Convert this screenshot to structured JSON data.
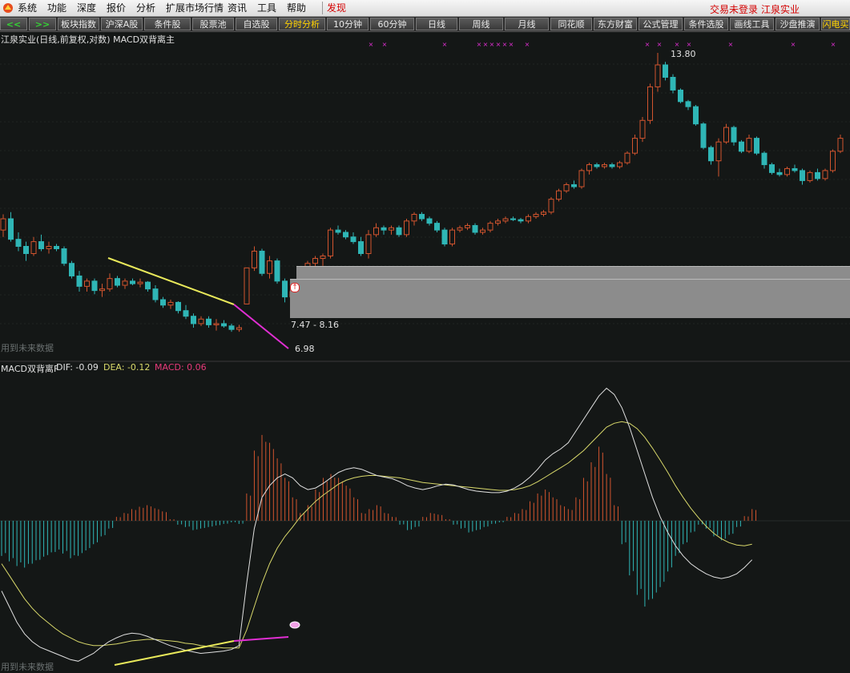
{
  "menubar": {
    "items": [
      "系统",
      "功能",
      "深度",
      "报价",
      "分析",
      "扩展市场行情",
      "资讯",
      "工具",
      "帮助",
      "发现"
    ],
    "status_login": "交易未登录",
    "status_stock": "江泉实业"
  },
  "toolbar": {
    "tabs": [
      "<<",
      ">>",
      "板块指数",
      "沪深A股",
      "条件股",
      "股票池",
      "自选股",
      "分时分析",
      "10分钟",
      "60分钟",
      "日线",
      "周线",
      "月线",
      "同花顺",
      "东方财富",
      "公式管理",
      "条件选股",
      "画线工具",
      "沙盘推演",
      "闪电买"
    ]
  },
  "price_panel": {
    "title": "江泉实业(日线,前复权,对数) MACD双背离主",
    "future_data_note": "用到未来数据",
    "high_label": "13.80",
    "range_label": "7.47 - 8.16",
    "low_label": "6.98"
  },
  "macd_panel": {
    "title": "MACD双背离F",
    "dif_label": "DIF: -0.09",
    "dea_label": "DEA: -0.12",
    "macd_label": "MACD: 0.06",
    "future_data_note": "用到未来数据"
  },
  "colors": {
    "up": "#d2542e",
    "down": "#2fb6b6",
    "divergence_yellow": "#e8e85a",
    "divergence_magenta": "#e02ed2",
    "dif_line": "#e0e0e0",
    "dea_line": "#d8d86a",
    "macd_label": "#e83a7a",
    "background": "#141716"
  },
  "chart_data": {
    "type": "candlestick",
    "notes": "Daily OHLC (front-adjusted, log scale) for 江泉实业 with MACD histogram (DIF/DEA).",
    "price_series": [
      {
        "o": 8.95,
        "h": 9.3,
        "l": 8.8,
        "c": 9.2
      },
      {
        "o": 9.2,
        "h": 9.35,
        "l": 8.7,
        "c": 8.75
      },
      {
        "o": 8.75,
        "h": 8.9,
        "l": 8.5,
        "c": 8.6
      },
      {
        "o": 8.6,
        "h": 8.7,
        "l": 8.3,
        "c": 8.45
      },
      {
        "o": 8.45,
        "h": 8.8,
        "l": 8.4,
        "c": 8.7
      },
      {
        "o": 8.7,
        "h": 8.85,
        "l": 8.5,
        "c": 8.55
      },
      {
        "o": 8.55,
        "h": 8.7,
        "l": 8.45,
        "c": 8.6
      },
      {
        "o": 8.6,
        "h": 8.65,
        "l": 8.5,
        "c": 8.55
      },
      {
        "o": 8.55,
        "h": 8.6,
        "l": 8.2,
        "c": 8.25
      },
      {
        "o": 8.25,
        "h": 8.3,
        "l": 7.95,
        "c": 8.0
      },
      {
        "o": 8.0,
        "h": 8.1,
        "l": 7.7,
        "c": 7.8
      },
      {
        "o": 7.8,
        "h": 7.95,
        "l": 7.7,
        "c": 7.9
      },
      {
        "o": 7.9,
        "h": 7.95,
        "l": 7.65,
        "c": 7.72
      },
      {
        "o": 7.72,
        "h": 7.85,
        "l": 7.6,
        "c": 7.75
      },
      {
        "o": 7.75,
        "h": 8.05,
        "l": 7.7,
        "c": 7.95
      },
      {
        "o": 7.95,
        "h": 8.0,
        "l": 7.78,
        "c": 7.82
      },
      {
        "o": 7.82,
        "h": 7.95,
        "l": 7.75,
        "c": 7.9
      },
      {
        "o": 7.9,
        "h": 7.95,
        "l": 7.82,
        "c": 7.85
      },
      {
        "o": 7.85,
        "h": 7.95,
        "l": 7.78,
        "c": 7.88
      },
      {
        "o": 7.88,
        "h": 7.9,
        "l": 7.7,
        "c": 7.75
      },
      {
        "o": 7.75,
        "h": 7.82,
        "l": 7.5,
        "c": 7.55
      },
      {
        "o": 7.55,
        "h": 7.6,
        "l": 7.4,
        "c": 7.45
      },
      {
        "o": 7.45,
        "h": 7.55,
        "l": 7.38,
        "c": 7.5
      },
      {
        "o": 7.5,
        "h": 7.52,
        "l": 7.3,
        "c": 7.35
      },
      {
        "o": 7.35,
        "h": 7.45,
        "l": 7.2,
        "c": 7.25
      },
      {
        "o": 7.25,
        "h": 7.3,
        "l": 7.05,
        "c": 7.12
      },
      {
        "o": 7.12,
        "h": 7.25,
        "l": 7.08,
        "c": 7.2
      },
      {
        "o": 7.2,
        "h": 7.25,
        "l": 7.05,
        "c": 7.1
      },
      {
        "o": 7.1,
        "h": 7.2,
        "l": 7.0,
        "c": 7.12
      },
      {
        "o": 7.12,
        "h": 7.18,
        "l": 7.05,
        "c": 7.08
      },
      {
        "o": 7.08,
        "h": 7.12,
        "l": 6.98,
        "c": 7.02
      },
      {
        "o": 7.02,
        "h": 7.1,
        "l": 6.98,
        "c": 7.05
      },
      {
        "o": 7.47,
        "h": 8.16,
        "l": 7.47,
        "c": 8.16
      },
      {
        "o": 8.16,
        "h": 8.6,
        "l": 8.1,
        "c": 8.5
      },
      {
        "o": 8.5,
        "h": 8.55,
        "l": 8.0,
        "c": 8.05
      },
      {
        "o": 8.05,
        "h": 8.4,
        "l": 7.95,
        "c": 8.3
      },
      {
        "o": 8.3,
        "h": 8.35,
        "l": 7.85,
        "c": 7.9
      },
      {
        "o": 7.9,
        "h": 7.95,
        "l": 7.5,
        "c": 7.6
      },
      {
        "o": 7.6,
        "h": 7.8,
        "l": 7.45,
        "c": 7.7
      },
      {
        "o": 7.7,
        "h": 8.05,
        "l": 7.65,
        "c": 8.0
      },
      {
        "o": 8.0,
        "h": 8.3,
        "l": 7.95,
        "c": 8.25
      },
      {
        "o": 8.25,
        "h": 8.4,
        "l": 8.15,
        "c": 8.35
      },
      {
        "o": 8.35,
        "h": 8.45,
        "l": 8.2,
        "c": 8.4
      },
      {
        "o": 8.4,
        "h": 9.0,
        "l": 8.35,
        "c": 8.95
      },
      {
        "o": 8.95,
        "h": 9.05,
        "l": 8.85,
        "c": 8.9
      },
      {
        "o": 8.9,
        "h": 8.95,
        "l": 8.75,
        "c": 8.8
      },
      {
        "o": 8.8,
        "h": 8.9,
        "l": 8.65,
        "c": 8.7
      },
      {
        "o": 8.7,
        "h": 8.8,
        "l": 8.4,
        "c": 8.45
      },
      {
        "o": 8.45,
        "h": 8.95,
        "l": 8.35,
        "c": 8.85
      },
      {
        "o": 8.85,
        "h": 9.1,
        "l": 8.8,
        "c": 9.0
      },
      {
        "o": 9.0,
        "h": 9.05,
        "l": 8.85,
        "c": 8.95
      },
      {
        "o": 8.95,
        "h": 9.05,
        "l": 8.85,
        "c": 9.0
      },
      {
        "o": 9.0,
        "h": 9.05,
        "l": 8.8,
        "c": 8.85
      },
      {
        "o": 8.85,
        "h": 9.2,
        "l": 8.8,
        "c": 9.15
      },
      {
        "o": 9.15,
        "h": 9.35,
        "l": 9.05,
        "c": 9.3
      },
      {
        "o": 9.3,
        "h": 9.35,
        "l": 9.15,
        "c": 9.2
      },
      {
        "o": 9.2,
        "h": 9.25,
        "l": 9.05,
        "c": 9.1
      },
      {
        "o": 9.1,
        "h": 9.15,
        "l": 8.9,
        "c": 8.95
      },
      {
        "o": 8.95,
        "h": 9.0,
        "l": 8.6,
        "c": 8.65
      },
      {
        "o": 8.65,
        "h": 9.0,
        "l": 8.6,
        "c": 8.95
      },
      {
        "o": 8.95,
        "h": 9.05,
        "l": 8.9,
        "c": 9.0
      },
      {
        "o": 9.0,
        "h": 9.1,
        "l": 8.95,
        "c": 9.05
      },
      {
        "o": 9.05,
        "h": 9.1,
        "l": 8.85,
        "c": 8.9
      },
      {
        "o": 8.9,
        "h": 9.0,
        "l": 8.85,
        "c": 8.95
      },
      {
        "o": 8.95,
        "h": 9.15,
        "l": 8.9,
        "c": 9.1
      },
      {
        "o": 9.1,
        "h": 9.2,
        "l": 9.05,
        "c": 9.15
      },
      {
        "o": 9.15,
        "h": 9.25,
        "l": 9.1,
        "c": 9.2
      },
      {
        "o": 9.2,
        "h": 9.25,
        "l": 9.15,
        "c": 9.18
      },
      {
        "o": 9.18,
        "h": 9.22,
        "l": 9.1,
        "c": 9.15
      },
      {
        "o": 9.15,
        "h": 9.3,
        "l": 9.1,
        "c": 9.25
      },
      {
        "o": 9.25,
        "h": 9.35,
        "l": 9.2,
        "c": 9.3
      },
      {
        "o": 9.3,
        "h": 9.4,
        "l": 9.25,
        "c": 9.35
      },
      {
        "o": 9.35,
        "h": 9.7,
        "l": 9.3,
        "c": 9.65
      },
      {
        "o": 9.65,
        "h": 9.9,
        "l": 9.6,
        "c": 9.85
      },
      {
        "o": 9.85,
        "h": 10.05,
        "l": 9.8,
        "c": 10.0
      },
      {
        "o": 10.0,
        "h": 10.1,
        "l": 9.9,
        "c": 9.95
      },
      {
        "o": 9.95,
        "h": 10.4,
        "l": 9.9,
        "c": 10.35
      },
      {
        "o": 10.35,
        "h": 10.55,
        "l": 10.25,
        "c": 10.5
      },
      {
        "o": 10.5,
        "h": 10.55,
        "l": 10.4,
        "c": 10.45
      },
      {
        "o": 10.45,
        "h": 10.55,
        "l": 10.4,
        "c": 10.5
      },
      {
        "o": 10.5,
        "h": 10.55,
        "l": 10.4,
        "c": 10.45
      },
      {
        "o": 10.45,
        "h": 10.6,
        "l": 10.4,
        "c": 10.55
      },
      {
        "o": 10.55,
        "h": 10.85,
        "l": 10.5,
        "c": 10.8
      },
      {
        "o": 10.8,
        "h": 11.3,
        "l": 10.75,
        "c": 11.2
      },
      {
        "o": 11.2,
        "h": 11.8,
        "l": 11.1,
        "c": 11.7
      },
      {
        "o": 11.7,
        "h": 12.8,
        "l": 11.6,
        "c": 12.7
      },
      {
        "o": 12.7,
        "h": 13.8,
        "l": 12.55,
        "c": 13.4
      },
      {
        "o": 13.4,
        "h": 13.5,
        "l": 12.9,
        "c": 13.0
      },
      {
        "o": 13.0,
        "h": 13.1,
        "l": 12.5,
        "c": 12.6
      },
      {
        "o": 12.6,
        "h": 12.65,
        "l": 12.2,
        "c": 12.25
      },
      {
        "o": 12.25,
        "h": 12.3,
        "l": 12.0,
        "c": 12.1
      },
      {
        "o": 12.1,
        "h": 12.15,
        "l": 11.55,
        "c": 11.6
      },
      {
        "o": 11.6,
        "h": 11.65,
        "l": 10.9,
        "c": 10.95
      },
      {
        "o": 10.95,
        "h": 11.0,
        "l": 10.5,
        "c": 10.6
      },
      {
        "o": 10.6,
        "h": 11.2,
        "l": 10.2,
        "c": 11.1
      },
      {
        "o": 11.1,
        "h": 11.6,
        "l": 11.05,
        "c": 11.5
      },
      {
        "o": 11.5,
        "h": 11.55,
        "l": 11.0,
        "c": 11.1
      },
      {
        "o": 11.1,
        "h": 11.15,
        "l": 10.8,
        "c": 10.85
      },
      {
        "o": 10.85,
        "h": 11.3,
        "l": 10.8,
        "c": 11.2
      },
      {
        "o": 11.2,
        "h": 11.25,
        "l": 10.75,
        "c": 10.8
      },
      {
        "o": 10.8,
        "h": 10.85,
        "l": 10.4,
        "c": 10.5
      },
      {
        "o": 10.5,
        "h": 10.55,
        "l": 10.25,
        "c": 10.3
      },
      {
        "o": 10.3,
        "h": 10.4,
        "l": 10.2,
        "c": 10.25
      },
      {
        "o": 10.25,
        "h": 10.45,
        "l": 10.2,
        "c": 10.4
      },
      {
        "o": 10.4,
        "h": 10.5,
        "l": 10.3,
        "c": 10.35
      },
      {
        "o": 10.35,
        "h": 10.4,
        "l": 10.0,
        "c": 10.1
      },
      {
        "o": 10.1,
        "h": 10.35,
        "l": 10.05,
        "c": 10.3
      },
      {
        "o": 10.3,
        "h": 10.4,
        "l": 10.1,
        "c": 10.15
      },
      {
        "o": 10.15,
        "h": 10.4,
        "l": 10.1,
        "c": 10.35
      },
      {
        "o": 10.35,
        "h": 10.9,
        "l": 10.3,
        "c": 10.85
      },
      {
        "o": 10.85,
        "h": 11.3,
        "l": 10.8,
        "c": 11.2
      }
    ],
    "macd_histogram": [
      -0.45,
      -0.52,
      -0.58,
      -0.6,
      -0.55,
      -0.5,
      -0.44,
      -0.4,
      -0.42,
      -0.48,
      -0.45,
      -0.38,
      -0.3,
      -0.2,
      -0.1,
      0.05,
      0.1,
      0.15,
      0.18,
      0.2,
      0.16,
      0.12,
      0.02,
      -0.05,
      -0.08,
      -0.12,
      -0.1,
      -0.08,
      -0.06,
      -0.04,
      -0.02,
      -0.04,
      0.35,
      0.9,
      1.1,
      1.0,
      0.8,
      0.55,
      0.3,
      0.1,
      0.2,
      0.4,
      0.55,
      0.6,
      0.55,
      0.45,
      0.3,
      0.1,
      0.15,
      0.2,
      0.1,
      0.05,
      -0.05,
      -0.12,
      -0.08,
      0.05,
      0.1,
      0.08,
      0.02,
      -0.05,
      -0.1,
      -0.15,
      -0.12,
      -0.08,
      -0.04,
      -0.02,
      0.05,
      0.1,
      0.15,
      0.25,
      0.35,
      0.4,
      0.3,
      0.2,
      0.15,
      0.3,
      0.55,
      0.75,
      0.95,
      0.6,
      0.2,
      -0.3,
      -0.7,
      -0.95,
      -1.1,
      -1.0,
      -0.85,
      -0.65,
      -0.45,
      -0.3,
      -0.15,
      -0.05,
      -0.1,
      -0.2,
      -0.25,
      -0.18,
      -0.08,
      0.06,
      0.15
    ],
    "dif_line": [
      -0.9,
      -1.1,
      -1.3,
      -1.45,
      -1.55,
      -1.62,
      -1.66,
      -1.7,
      -1.74,
      -1.78,
      -1.8,
      -1.75,
      -1.7,
      -1.62,
      -1.55,
      -1.5,
      -1.46,
      -1.44,
      -1.45,
      -1.48,
      -1.52,
      -1.56,
      -1.6,
      -1.63,
      -1.66,
      -1.68,
      -1.7,
      -1.69,
      -1.68,
      -1.67,
      -1.65,
      -1.6,
      -0.8,
      -0.1,
      0.3,
      0.45,
      0.55,
      0.6,
      0.55,
      0.45,
      0.4,
      0.42,
      0.48,
      0.55,
      0.62,
      0.66,
      0.68,
      0.66,
      0.62,
      0.58,
      0.56,
      0.54,
      0.5,
      0.45,
      0.42,
      0.4,
      0.42,
      0.45,
      0.47,
      0.46,
      0.43,
      0.4,
      0.38,
      0.37,
      0.36,
      0.36,
      0.38,
      0.42,
      0.48,
      0.56,
      0.66,
      0.78,
      0.86,
      0.92,
      1.0,
      1.15,
      1.3,
      1.45,
      1.6,
      1.7,
      1.62,
      1.45,
      1.2,
      0.9,
      0.6,
      0.3,
      0.05,
      -0.15,
      -0.32,
      -0.45,
      -0.55,
      -0.62,
      -0.68,
      -0.72,
      -0.74,
      -0.72,
      -0.68,
      -0.6,
      -0.5
    ],
    "dea_line": [
      -0.55,
      -0.7,
      -0.85,
      -1.0,
      -1.12,
      -1.22,
      -1.3,
      -1.38,
      -1.45,
      -1.5,
      -1.55,
      -1.58,
      -1.6,
      -1.6,
      -1.59,
      -1.58,
      -1.56,
      -1.54,
      -1.53,
      -1.52,
      -1.52,
      -1.53,
      -1.54,
      -1.55,
      -1.57,
      -1.58,
      -1.6,
      -1.61,
      -1.62,
      -1.63,
      -1.63,
      -1.63,
      -1.4,
      -1.1,
      -0.8,
      -0.55,
      -0.35,
      -0.2,
      -0.08,
      0.05,
      0.15,
      0.25,
      0.33,
      0.4,
      0.47,
      0.52,
      0.55,
      0.57,
      0.58,
      0.58,
      0.57,
      0.56,
      0.55,
      0.53,
      0.51,
      0.49,
      0.48,
      0.47,
      0.46,
      0.45,
      0.44,
      0.43,
      0.42,
      0.41,
      0.4,
      0.39,
      0.39,
      0.4,
      0.42,
      0.45,
      0.5,
      0.56,
      0.62,
      0.68,
      0.74,
      0.82,
      0.9,
      1.0,
      1.1,
      1.2,
      1.25,
      1.27,
      1.25,
      1.18,
      1.07,
      0.93,
      0.78,
      0.62,
      0.45,
      0.3,
      0.16,
      0.04,
      -0.07,
      -0.16,
      -0.23,
      -0.28,
      -0.31,
      -0.32,
      -0.3
    ]
  }
}
